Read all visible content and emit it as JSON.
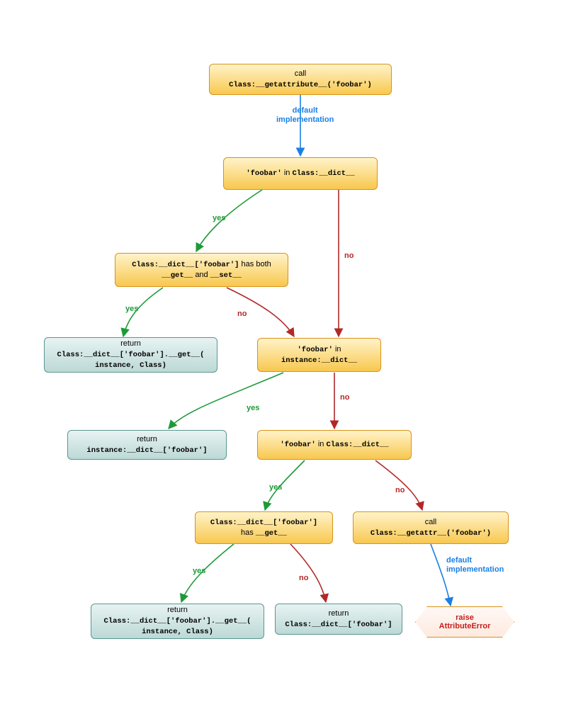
{
  "nodes": {
    "n1": {
      "label1_plain": "call",
      "label2_code": "Class:__getattribute__('foobar')"
    },
    "n2": {
      "code1": "'foobar'",
      "plain_in": " in ",
      "code2": "Class:__dict__"
    },
    "n3": {
      "code1": "Class:__dict__['foobar']",
      "plain1": " has both",
      "code2": "__get__",
      "plain_and": " and ",
      "code3": "__set__"
    },
    "n4": {
      "plain1": "return",
      "code1": "Class:__dict__['foobar'].__get__(",
      "code2": "instance, Class)"
    },
    "n5": {
      "code1": "'foobar'",
      "plain_in": " in",
      "code2": "instance:__dict__"
    },
    "n6": {
      "plain1": "return",
      "code1": "instance:__dict__['foobar']"
    },
    "n7": {
      "code1": "'foobar'",
      "plain_in": " in ",
      "code2": "Class:__dict__"
    },
    "n8": {
      "code1": "Class:__dict__['foobar']",
      "plain1": "has ",
      "code2": "__get__"
    },
    "n9": {
      "plain1": "call",
      "code1": "Class:__getattr__('foobar')"
    },
    "n10": {
      "plain1": "return",
      "code1": "Class:__dict__['foobar'].__get__(",
      "code2": "instance, Class)"
    },
    "n11": {
      "plain1": "return",
      "code1": "Class:__dict__['foobar']"
    },
    "n12": {
      "line1": "raise",
      "line2": "AttributeError"
    }
  },
  "edges": {
    "e1": {
      "label": "default\nimplementation"
    },
    "yes": "yes",
    "no": "no",
    "e_def2": {
      "label": "default\nimplementation"
    }
  }
}
